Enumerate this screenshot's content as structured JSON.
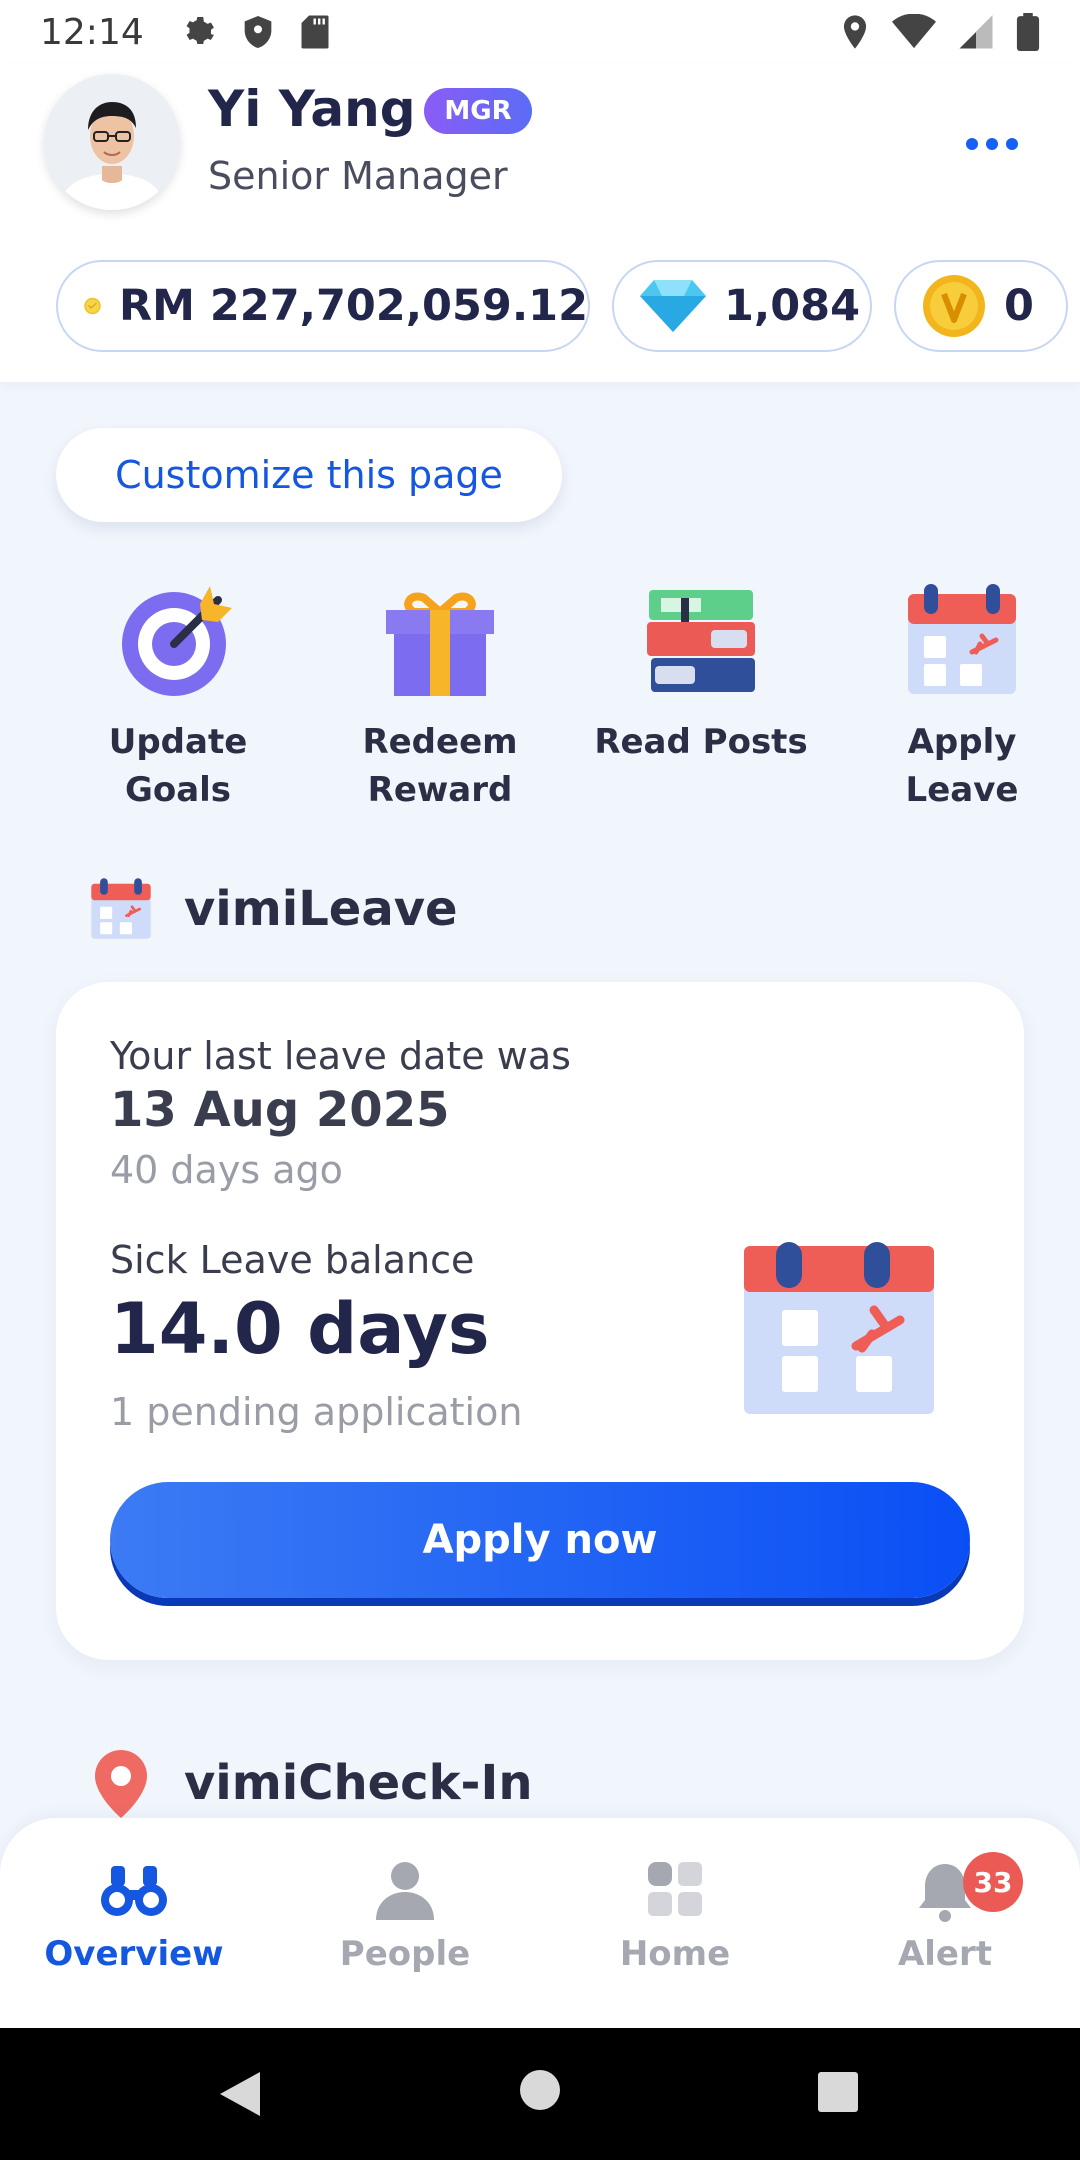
{
  "status_bar": {
    "time": "12:14",
    "left_icons": [
      "gear-icon",
      "shield-icon",
      "sd-card-icon"
    ],
    "right_icons": [
      "location-icon",
      "wifi-icon",
      "signal-icon",
      "battery-icon"
    ]
  },
  "profile": {
    "name": "Yi Yang",
    "badge": "MGR",
    "role": "Senior Manager"
  },
  "wallet": {
    "balance": "RM 227,702,059.12",
    "diamonds": "1,084",
    "coins": "0"
  },
  "customize_label": "Customize this page",
  "quick_actions": [
    {
      "label": "Update Goals",
      "icon": "target-icon"
    },
    {
      "label": "Redeem Reward",
      "icon": "gift-icon"
    },
    {
      "label": "Read Posts",
      "icon": "books-icon"
    },
    {
      "label": "Apply Leave",
      "icon": "calendar-leave-icon"
    }
  ],
  "leave_section": {
    "title": "vimiLeave",
    "last_leave_label": "Your last leave date was",
    "last_leave_date": "13 Aug 2025",
    "days_ago": "40 days ago",
    "balance_label": "Sick Leave balance",
    "balance_value": "14.0 days",
    "pending": "1 pending application",
    "apply_label": "Apply now"
  },
  "checkin_section": {
    "title": "vimiCheck-In"
  },
  "bottom_nav": {
    "items": [
      {
        "label": "Overview",
        "icon": "binoculars-icon",
        "active": true
      },
      {
        "label": "People",
        "icon": "person-icon",
        "active": false
      },
      {
        "label": "Home",
        "icon": "grid-icon",
        "active": false
      },
      {
        "label": "Alert",
        "icon": "bell-icon",
        "active": false,
        "badge": "33"
      }
    ]
  },
  "colors": {
    "accent": "#1557e0",
    "badge_purple": "#7c5cf6",
    "alert_red": "#ec5a56",
    "background": "#f1f5fc"
  }
}
